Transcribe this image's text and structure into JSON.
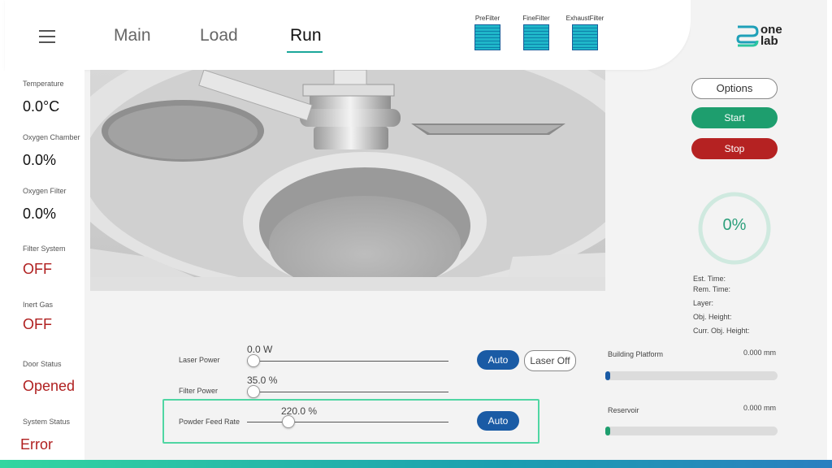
{
  "header": {
    "tabs": [
      {
        "label": "Main",
        "active": false
      },
      {
        "label": "Load",
        "active": false
      },
      {
        "label": "Run",
        "active": true
      }
    ],
    "filters": [
      {
        "label": "PreFilter"
      },
      {
        "label": "FineFilter"
      },
      {
        "label": "ExhaustFilter"
      }
    ],
    "logo": {
      "line1": "one",
      "line2": "lab"
    }
  },
  "sidebar": {
    "stats": [
      {
        "label": "Temperature",
        "value": "0.0°C",
        "alert": false
      },
      {
        "label": "Oxygen Chamber",
        "value": "0.0%",
        "alert": false
      },
      {
        "label": "Oxygen Filter",
        "value": "0.0%",
        "alert": false
      },
      {
        "label": "Filter System",
        "value": "OFF",
        "alert": true
      },
      {
        "label": "Inert Gas",
        "value": "OFF",
        "alert": true
      },
      {
        "label": "Door Status",
        "value": "Opened",
        "alert": true
      },
      {
        "label": "System Status",
        "value": "Error",
        "alert": true
      }
    ]
  },
  "right_panel": {
    "options_label": "Options",
    "start_label": "Start",
    "stop_label": "Stop",
    "progress_text": "0%",
    "progress_fraction": 0,
    "info": [
      {
        "label": "Est. Time:"
      },
      {
        "label": "Rem. Time:"
      },
      {
        "label": "Layer:"
      },
      {
        "label": "Obj. Height:"
      },
      {
        "label": "Curr. Obj. Height:"
      }
    ]
  },
  "controls": {
    "laser_power": {
      "label": "Laser Power",
      "value": "0.0 W",
      "position_fraction": 0.03,
      "auto_label": "Auto",
      "laser_off_label": "Laser Off"
    },
    "filter_power": {
      "label": "Filter Power",
      "value": "35.0 %",
      "position_fraction": 0.03
    },
    "powder_feed_rate": {
      "label": "Powder Feed Rate",
      "value": "220.0 %",
      "position_fraction": 0.2,
      "auto_label": "Auto"
    }
  },
  "levels": {
    "building_platform": {
      "label": "Building Platform",
      "value": "0.000 mm",
      "fill_fraction": 0.02,
      "color": "#1a5ba5"
    },
    "reservoir": {
      "label": "Reservoir",
      "value": "0.000 mm",
      "fill_fraction": 0.02,
      "color": "#1e9e6e"
    }
  }
}
